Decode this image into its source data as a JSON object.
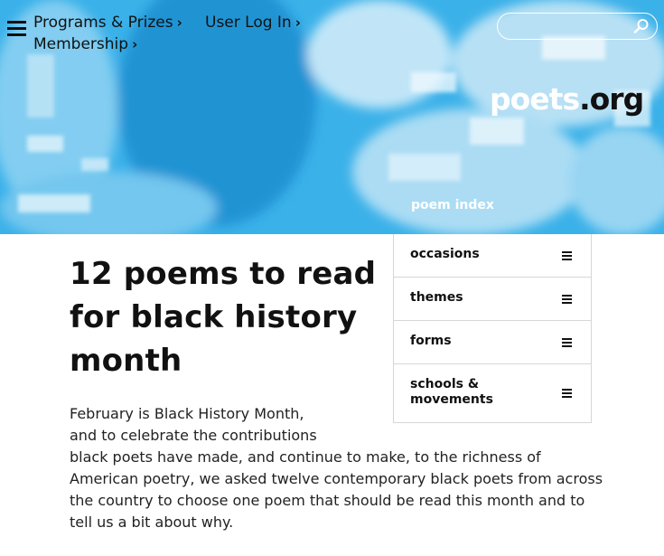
{
  "nav": {
    "programs_label": "Programs & Prizes",
    "login_label": "User Log In",
    "membership_label": "Membership",
    "chevron": "›"
  },
  "search": {
    "placeholder": ""
  },
  "logo": {
    "part1": "poets",
    "part2": ".org"
  },
  "poem_index": {
    "title": "poem index",
    "items": [
      {
        "label": "occasions"
      },
      {
        "label": "themes"
      },
      {
        "label": "forms"
      },
      {
        "label": "schools & movements"
      }
    ]
  },
  "article": {
    "title": "12 poems to read for black history month",
    "intro_lines": [
      "February is Black History Month,",
      "and to celebrate the contributions",
      "black poets have made, and continue to make, to the richness of",
      "American poetry, we asked twelve contemporary black poets from across",
      "the country to choose one poem that should be read this month and to",
      "tell us a bit about why."
    ]
  },
  "icons": {
    "menu": "hamburger-icon",
    "search": "search-icon",
    "list": "list-icon"
  },
  "colors": {
    "hero_blue": "#3db3ea",
    "text_dark": "#111111",
    "border": "#d6d6d6"
  }
}
